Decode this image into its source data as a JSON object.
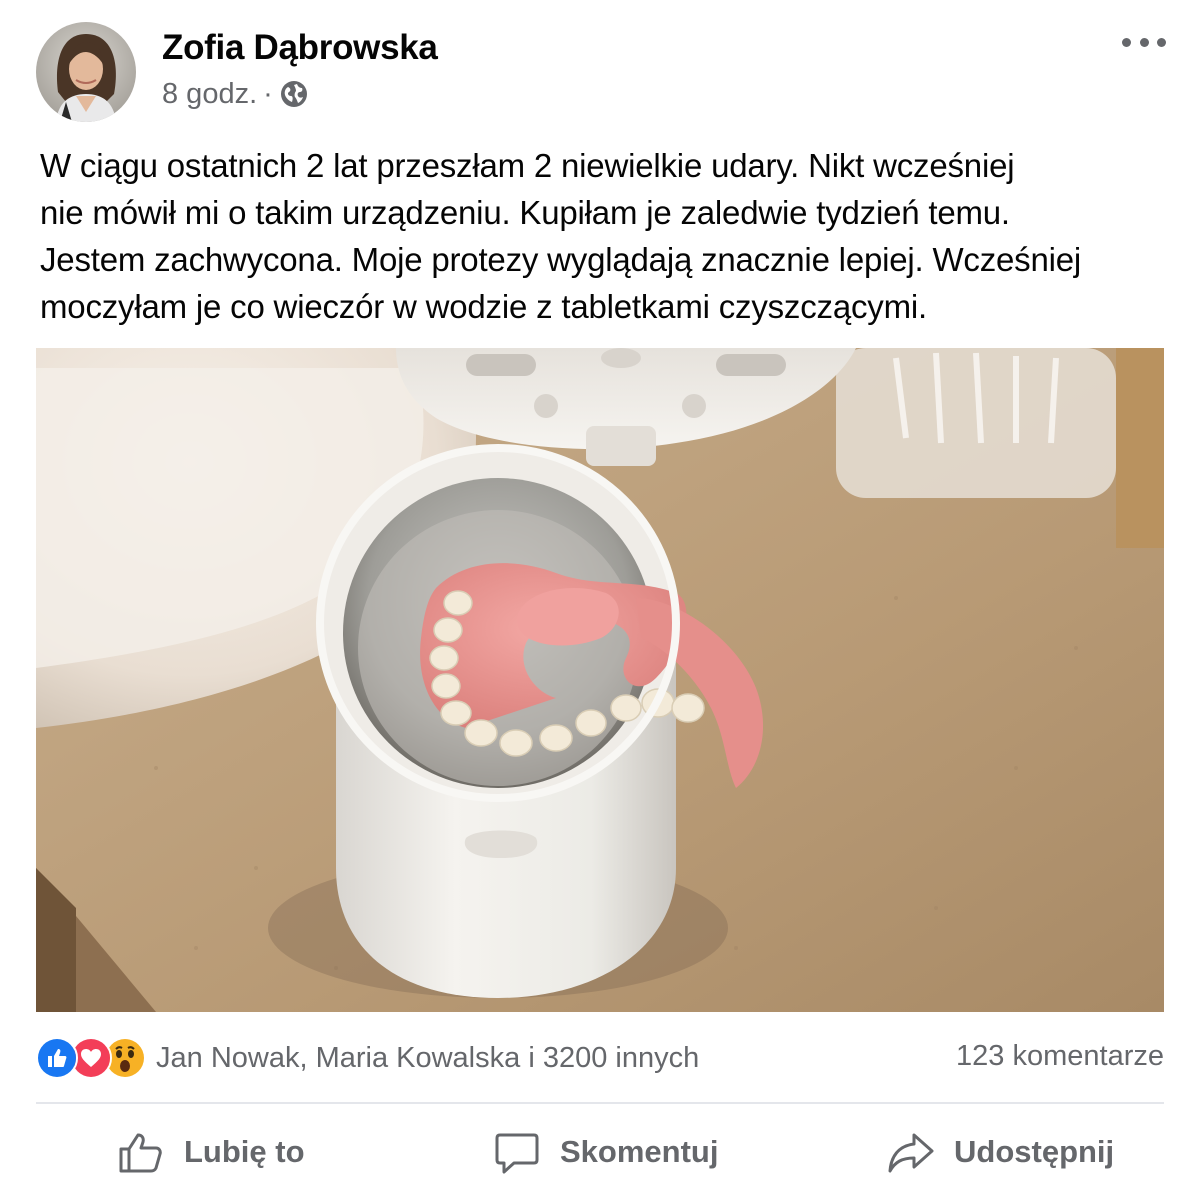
{
  "post": {
    "author": "Zofia Dąbrowska",
    "time": "8 godz.",
    "separator": "·",
    "audience_icon": "globe-icon",
    "menu_icon": "more-options-icon",
    "text_lines": [
      "W ciągu ostatnich 2 lat przeszłam 2 niewielkie udary. Nikt wcześniej",
      "nie mówił mi o takim urządzeniu. Kupiłam je zaledwie tydzień temu.",
      "Jestem zachwycona. Moje protezy wyglądają znacznie lepiej. Wcześniej",
      "moczyłam je co wieczór w wodzie z tabletkami czyszczącymi."
    ]
  },
  "engagement": {
    "reaction_icons": [
      "like-reaction-icon",
      "love-reaction-icon",
      "wow-reaction-icon"
    ],
    "reactors": "Jan Nowak, Maria Kowalska i 3200 innych",
    "comments": "123 komentarze"
  },
  "actions": {
    "like": "Lubię to",
    "comment": "Skomentuj",
    "share": "Udostępnij"
  },
  "colors": {
    "text": "#050505",
    "secondary": "#65676b",
    "like_blue": "#1877f2",
    "love_red": "#f33e58",
    "wow_yellow": "#f7b125",
    "divider": "#e4e6eb"
  }
}
